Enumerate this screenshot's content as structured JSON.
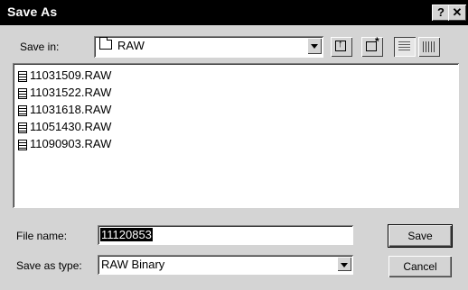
{
  "window": {
    "title": "Save As",
    "help_label": "?",
    "close_label": "✕"
  },
  "location": {
    "label": "Save in:",
    "value": "RAW"
  },
  "toolbar": {
    "icons": [
      "up-folder-icon",
      "new-folder-icon",
      "list-view-icon",
      "details-view-icon"
    ]
  },
  "files": [
    "11031509.RAW",
    "11031522.RAW",
    "11031618.RAW",
    "11051430.RAW",
    "11090903.RAW"
  ],
  "filename": {
    "label": "File name:",
    "value": "11120853"
  },
  "filetype": {
    "label": "Save as type:",
    "value": "RAW Binary"
  },
  "buttons": {
    "save": "Save",
    "cancel": "Cancel"
  }
}
